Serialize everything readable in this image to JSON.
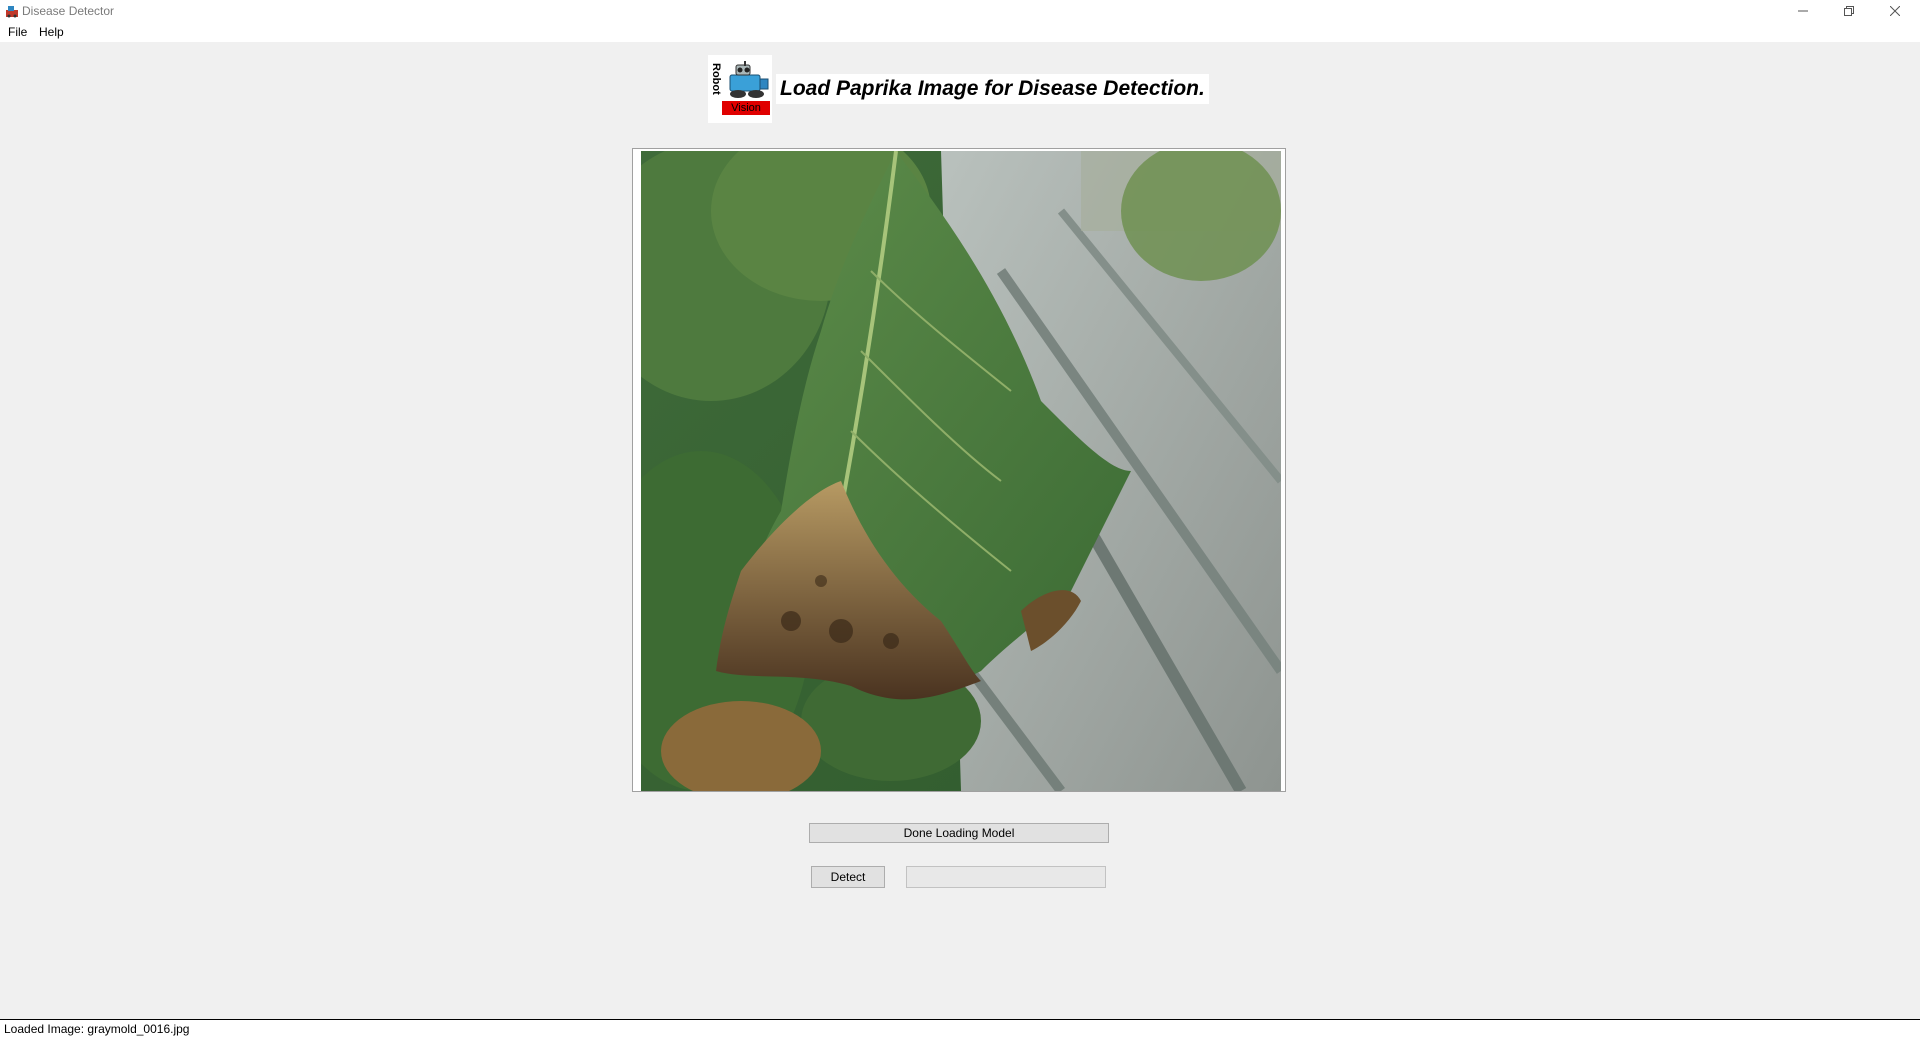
{
  "window": {
    "title": "Disease Detector",
    "icon": "app-icon"
  },
  "menu": {
    "items": [
      {
        "label": "File"
      },
      {
        "label": "Help"
      }
    ]
  },
  "header": {
    "logo_text_vertical": "Robot",
    "logo_text_banner": "Vision",
    "title": "Load Paprika Image for Disease Detection."
  },
  "image": {
    "description_icon": "leaf-photo",
    "file_name": "graymold_0016.jpg"
  },
  "controls": {
    "status_text": "Done Loading Model",
    "detect_label": "Detect",
    "result_text": ""
  },
  "statusbar": {
    "text": "Loaded Image: graymold_0016.jpg"
  },
  "colors": {
    "background": "#f0f0f0",
    "logo_banner": "#e00000",
    "button_face": "#e1e1e1"
  }
}
